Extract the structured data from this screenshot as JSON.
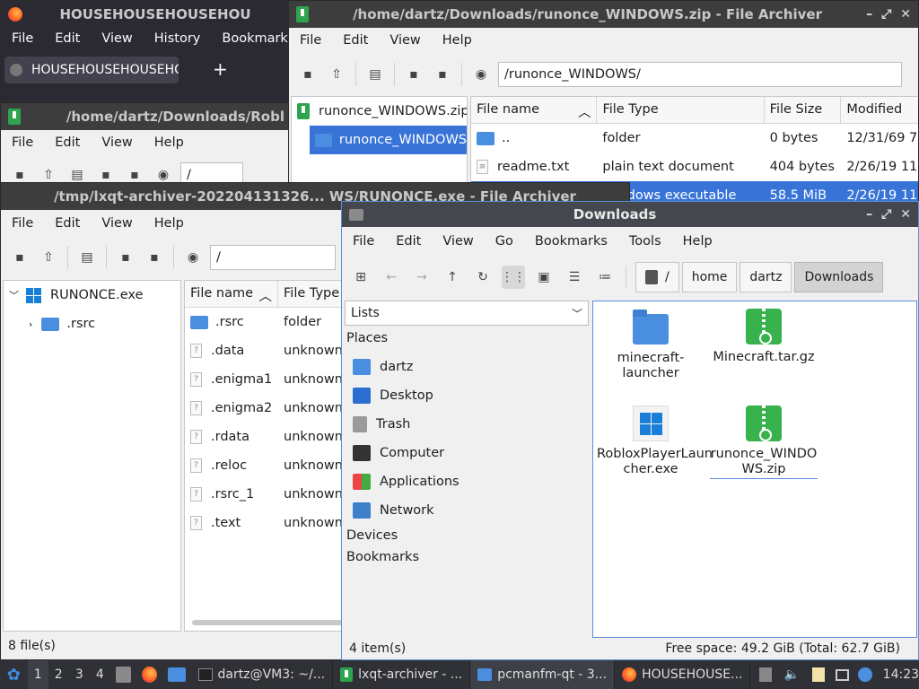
{
  "firefox": {
    "title": "HOUSEHOUSEHOUSEHOU",
    "menu": [
      "File",
      "Edit",
      "View",
      "History",
      "Bookmarks"
    ],
    "tab": "HOUSEHOUSEHOUSEHOU"
  },
  "zip_window": {
    "title": "/home/dartz/Downloads/runonce_WINDOWS.zip - File Archiver",
    "menu": [
      "File",
      "Edit",
      "View",
      "Help"
    ],
    "path": "/runonce_WINDOWS/",
    "tree": [
      "runonce_WINDOWS.zip",
      "runonce_WINDOWS"
    ],
    "columns": [
      "File name",
      "File Type",
      "File Size",
      "Modified"
    ],
    "rows": [
      {
        "name": "..",
        "type": "folder",
        "size": "0 bytes",
        "modified": "12/31/69 7:"
      },
      {
        "name": "readme.txt",
        "type": "plain text document",
        "size": "404 bytes",
        "modified": "2/26/19 11:"
      },
      {
        "name": "",
        "type": "Windows executable",
        "size": "58.5 MiB",
        "modified": "2/26/19 11:"
      }
    ]
  },
  "roblox_window": {
    "title": "/home/dartz/Downloads/Robl",
    "menu": [
      "File",
      "Edit",
      "View",
      "Help"
    ],
    "path": "/"
  },
  "exe_window": {
    "title": "/tmp/lxqt-archiver-202204131326... WS/RUNONCE.exe - File Archiver",
    "menu": [
      "File",
      "Edit",
      "View",
      "Help"
    ],
    "path": "/",
    "tree": [
      "RUNONCE.exe",
      ".rsrc"
    ],
    "columns": [
      "File name",
      "File Type"
    ],
    "rows": [
      {
        "name": ".rsrc",
        "type": "folder"
      },
      {
        "name": ".data",
        "type": "unknown"
      },
      {
        "name": ".enigma1",
        "type": "unknown"
      },
      {
        "name": ".enigma2",
        "type": "unknown"
      },
      {
        "name": ".rdata",
        "type": "unknown"
      },
      {
        "name": ".reloc",
        "type": "unknown"
      },
      {
        "name": ".rsrc_1",
        "type": "unknown"
      },
      {
        "name": ".text",
        "type": "unknown"
      }
    ],
    "status": "8 file(s)"
  },
  "downloads": {
    "title": "Downloads",
    "menu": [
      "File",
      "Edit",
      "View",
      "Go",
      "Bookmarks",
      "Tools",
      "Help"
    ],
    "crumbs": [
      "/",
      "home",
      "dartz",
      "Downloads"
    ],
    "side_select": "Lists",
    "places_header": "Places",
    "places": [
      "dartz",
      "Desktop",
      "Trash",
      "Computer",
      "Applications",
      "Network"
    ],
    "devices": "Devices",
    "bookmarks": "Bookmarks",
    "files": [
      "minecraft-\nlauncher",
      "Minecraft.tar.gz",
      "RobloxPlayerLaun\ncher.exe",
      "runonce_WINDO\nWS.zip"
    ],
    "status_left": "4 item(s)",
    "status_right": "Free space: 49.2 GiB (Total: 62.7 GiB)"
  },
  "taskbar": {
    "desktops": [
      "1",
      "2",
      "3",
      "4"
    ],
    "tasks": [
      "dartz@VM3: ~/...",
      "lxqt-archiver - ...",
      "pcmanfm-qt - 3...",
      "HOUSEHOUSE..."
    ],
    "clock": "14:23"
  }
}
